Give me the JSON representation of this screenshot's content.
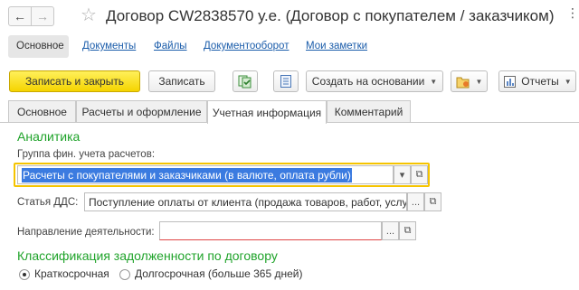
{
  "window": {
    "title": "Договор CW2838570 у.е. (Договор с покупателем / заказчиком)",
    "back_icon": "←",
    "forward_icon": "→",
    "favorite_icon": "☆",
    "more_icon": "⋮"
  },
  "topnav": {
    "items": [
      {
        "label": "Основное",
        "active": true
      },
      {
        "label": "Документы"
      },
      {
        "label": "Файлы"
      },
      {
        "label": "Документооборот"
      },
      {
        "label": "Мои заметки"
      }
    ]
  },
  "toolbar": {
    "save_close_label": "Записать и закрыть",
    "save_label": "Записать",
    "create_based_label": "Создать на основании",
    "reports_label": "Отчеты",
    "dropdown_glyph": "▼"
  },
  "tabs": [
    {
      "label": "Основное"
    },
    {
      "label": "Расчеты и оформление"
    },
    {
      "label": "Учетная информация",
      "active": true
    },
    {
      "label": "Комментарий"
    }
  ],
  "analytics": {
    "section_title": "Аналитика",
    "group_label": "Группа фин. учета расчетов:",
    "group_value": "Расчеты с покупателями и заказчиками (в валюте, оплата рубли)",
    "dds_label": "Статья ДДС:",
    "dds_value": "Поступление оплаты от клиента (продажа товаров, работ, услуг)",
    "direction_label": "Направление деятельности:",
    "direction_value": "",
    "select_glyph": "...",
    "dropdown_glyph": "▾",
    "open_glyph": "⧉"
  },
  "classification": {
    "section_title": "Классификация задолженности по договору",
    "options": [
      {
        "label": "Краткосрочная",
        "checked": true
      },
      {
        "label": "Долгосрочная (больше 365 дней)",
        "checked": false
      }
    ]
  },
  "colors": {
    "accent_green": "#1fa32a",
    "primary_yellow": "#f5d400",
    "link_blue": "#1a5caa",
    "selection_blue": "#3b7be0",
    "invalid_red": "#e04545"
  }
}
